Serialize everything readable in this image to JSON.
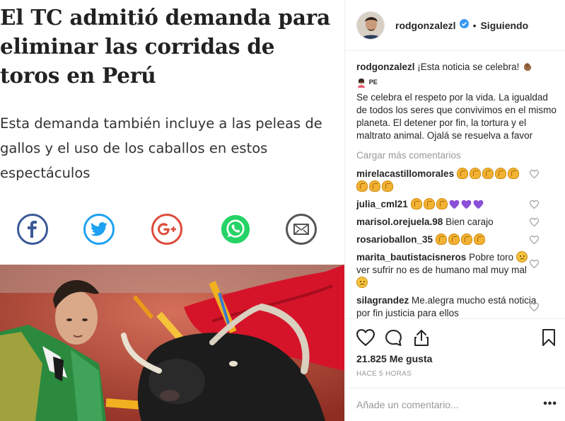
{
  "post_image": {
    "headline": "El TC admitió demanda para eliminar las corridas de toros en Perú",
    "subhead": "Esta demanda también incluye a las peleas de gallos y el uso de los caballos en estos espectáculos",
    "share_icons": [
      "facebook-icon",
      "twitter-icon",
      "google-plus-icon",
      "whatsapp-icon",
      "email-icon"
    ],
    "colors": {
      "facebook": "#3b5998",
      "twitter": "#1da1f2",
      "google_plus": "#dd4b39",
      "whatsapp": "#25d366",
      "email": "#555555"
    }
  },
  "header": {
    "username": "rodgonzalezl",
    "separator": "•",
    "follow_state": "Siguiendo"
  },
  "caption": {
    "username": "rodgonzalezl",
    "first_line": "¡Esta noticia se celebra!",
    "pe_label": "PE",
    "body": "Se celebra el respeto por la vida. La igualdad de todos los seres que convivimos en el mismo planeta. El detener por fin, la tortura y el maltrato animal. Ojalá se resuelva a favor"
  },
  "load_more": "Cargar más comentarios",
  "comments": [
    {
      "username": "mirelacastillomorales",
      "text": "",
      "claps": 8
    },
    {
      "username": "julia_cml21",
      "text": "",
      "claps": 3,
      "purple_hearts": 3
    },
    {
      "username": "marisol.orejuela.98",
      "text": "Bien carajo"
    },
    {
      "username": "rosarioballon_35",
      "text": "",
      "claps": 4
    },
    {
      "username": "marita_bautistacisneros",
      "text_a": "Pobre toro",
      "text_b": "ver sufrir no es de humano mal muy mal"
    },
    {
      "username": "silagrandez",
      "text": "Me.alegra mucho está noticia por fin justicia para ellos"
    }
  ],
  "actions": {
    "likes": "21.825 Me gusta",
    "time": "HACE 5 HORAS"
  },
  "add_comment": {
    "placeholder": "Añade un comentario...",
    "more": "•••"
  }
}
